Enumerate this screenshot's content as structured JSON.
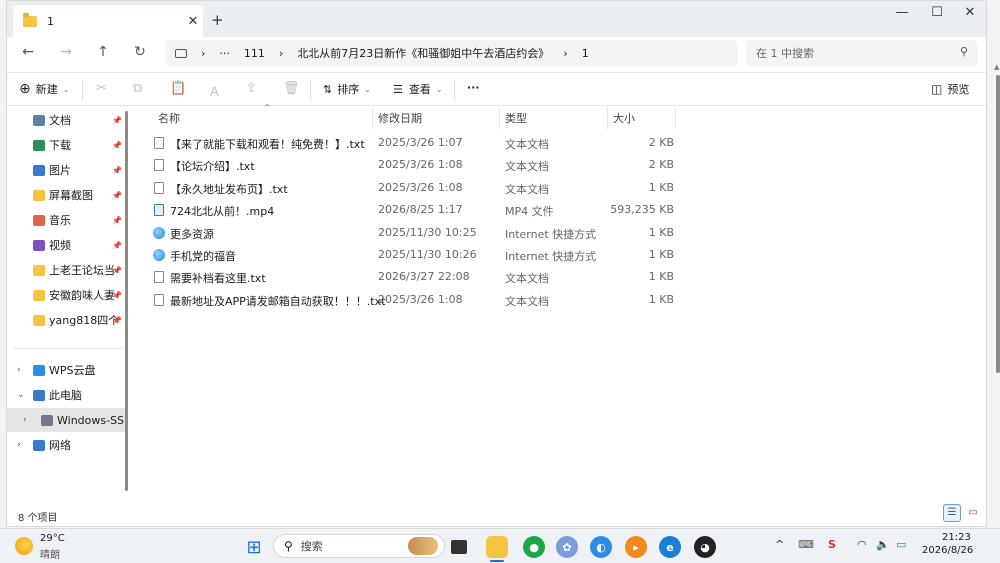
{
  "tab": {
    "title": "1",
    "close": "✕",
    "new": "+"
  },
  "window_controls": {
    "minimize": "—",
    "maximize": "☐",
    "close": "✕"
  },
  "nav": {
    "back": "←",
    "forward": "→",
    "up": "↑",
    "refresh": "↻"
  },
  "breadcrumb": [
    "›",
    "···",
    "111",
    "›",
    "北北从前7月23日新作《和骚御姐中午去酒店约会》",
    "›",
    "1"
  ],
  "search": {
    "placeholder": "在 1 中搜索",
    "icon": "⚲"
  },
  "toolbar": {
    "new_label": "新建",
    "new_icon": "⊕",
    "sort_label": "排序",
    "view_label": "查看",
    "more_label": "···",
    "preview_label": "预览",
    "cut_icon": "✂",
    "copy_icon": "⧉",
    "paste_icon": "📋",
    "rename_icon": "Ａ",
    "share_icon": "⇪",
    "delete_icon": "🗑"
  },
  "sidebar": {
    "quick": [
      {
        "label": "文档",
        "icon": "document-icon",
        "color": "#5b7fa6"
      },
      {
        "label": "下载",
        "icon": "download-icon",
        "color": "#2f8f5b"
      },
      {
        "label": "图片",
        "icon": "picture-icon",
        "color": "#3a78c9"
      },
      {
        "label": "屏幕截图",
        "icon": "folder-icon",
        "color": "#f5c542"
      },
      {
        "label": "音乐",
        "icon": "music-icon",
        "color": "#e0654d"
      },
      {
        "label": "视频",
        "icon": "video-icon",
        "color": "#7a4fc2"
      },
      {
        "label": "上老王论坛当",
        "icon": "folder-icon",
        "color": "#f5c542"
      },
      {
        "label": "安徽韵味人妻",
        "icon": "folder-icon",
        "color": "#f5c542"
      },
      {
        "label": "yang818四个",
        "icon": "folder-icon",
        "color": "#f5c542"
      }
    ],
    "pin": "📌",
    "tree": [
      {
        "label": "WPS云盘",
        "expander": "›",
        "icon": "cloud-icon",
        "color": "#2a8be8"
      },
      {
        "label": "此电脑",
        "expander": "⌄",
        "icon": "computer-icon",
        "color": "#3a78c9"
      },
      {
        "label": "Windows-SSD",
        "expander": "›",
        "icon": "drive-icon",
        "color": "#6b7a8c"
      },
      {
        "label": "网络",
        "expander": "›",
        "icon": "network-icon",
        "color": "#3a78c9"
      }
    ]
  },
  "columns": {
    "name": "名称",
    "date": "修改日期",
    "type": "类型",
    "size": "大小"
  },
  "files": [
    {
      "name": "【来了就能下载和观看！纯免费！】.txt",
      "date": "2025/3/26 1:07",
      "type": "文本文档",
      "size": "2 KB",
      "kind": "txt"
    },
    {
      "name": "【论坛介绍】.txt",
      "date": "2025/3/26 1:08",
      "type": "文本文档",
      "size": "2 KB",
      "kind": "txt"
    },
    {
      "name": "【永久地址发布页】.txt",
      "date": "2025/3/26 1:08",
      "type": "文本文档",
      "size": "1 KB",
      "kind": "txt"
    },
    {
      "name": "724北北从前！.mp4",
      "date": "2026/8/25 1:17",
      "type": "MP4 文件",
      "size": "593,235 KB",
      "kind": "mp4"
    },
    {
      "name": "更多资源",
      "date": "2025/11/30 10:25",
      "type": "Internet 快捷方式",
      "size": "1 KB",
      "kind": "url"
    },
    {
      "name": "手机党的福音",
      "date": "2025/11/30 10:26",
      "type": "Internet 快捷方式",
      "size": "1 KB",
      "kind": "url"
    },
    {
      "name": "需要补档看这里.txt",
      "date": "2026/3/27 22:08",
      "type": "文本文档",
      "size": "1 KB",
      "kind": "txt"
    },
    {
      "name": "最新地址及APP请发邮箱自动获取！！！.txt",
      "date": "2025/3/26 1:08",
      "type": "文本文档",
      "size": "1 KB",
      "kind": "txt"
    }
  ],
  "status": {
    "count": "8 个项目"
  },
  "taskbar": {
    "weather_temp": "29°C",
    "weather_desc": "晴朗",
    "search_placeholder": "搜索",
    "tray_chevron": "^",
    "clock_time": "21:23",
    "clock_date": "2026/8/26"
  }
}
